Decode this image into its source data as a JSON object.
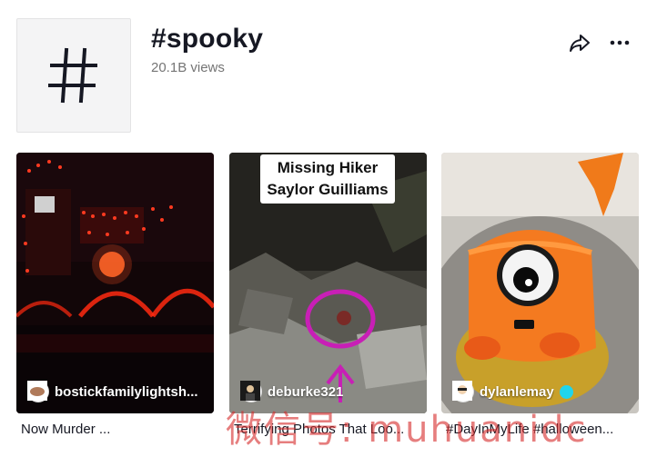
{
  "hashtag": {
    "title": "#spooky",
    "views": "20.1B views"
  },
  "actions": {
    "share_icon": "share-arrow-icon",
    "more_icon": "more-horizontal-icon"
  },
  "videos": [
    {
      "author": "bostickfamilylightsh...",
      "caption": "Now Murder ...",
      "verified": false
    },
    {
      "author": "deburke321",
      "caption": "Terrifying Photos That Loo...",
      "overlay_text_line1": "Missing Hiker",
      "overlay_text_line2": "Saylor Guilliams",
      "verified": false
    },
    {
      "author": "dylanlemay",
      "caption": "#DayInMyLife #halloween...",
      "verified": true
    }
  ],
  "watermark": "微信号: muhuanidc",
  "colors": {
    "verified": "#20d5ec",
    "text_primary": "#161823",
    "text_secondary": "#757575",
    "circle_highlight": "#c81fb6"
  }
}
